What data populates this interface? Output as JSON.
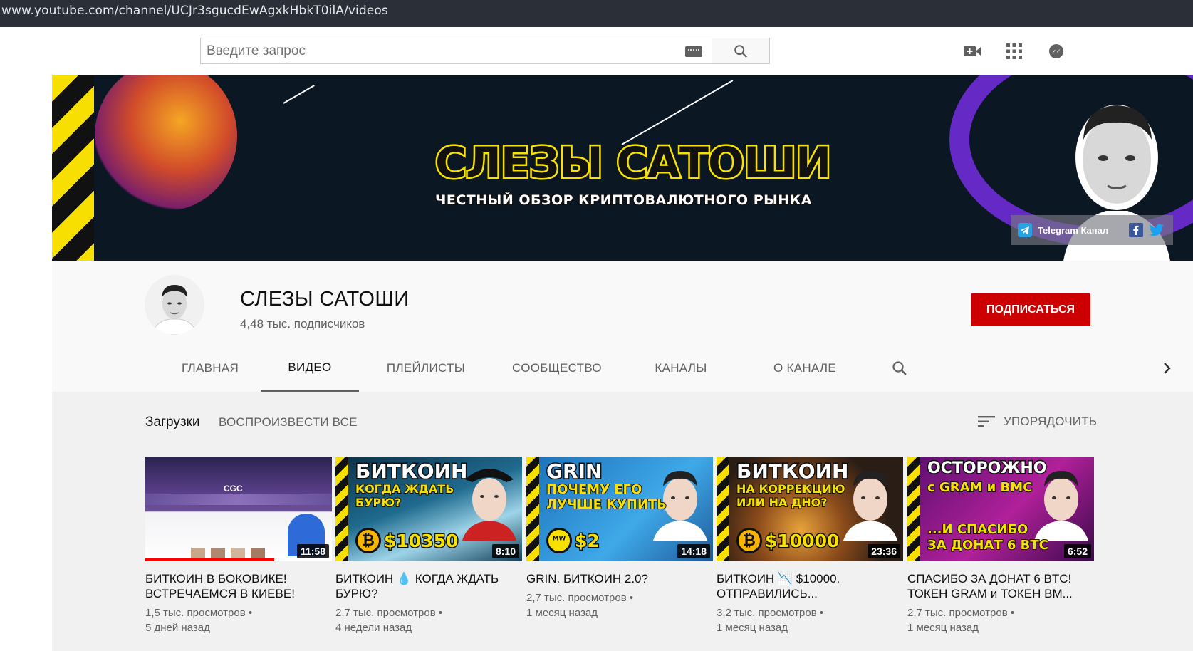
{
  "browser": {
    "url": "www.youtube.com/channel/UCJr3sgucdEwAgxkHbkT0ilA/videos"
  },
  "masthead": {
    "search_placeholder": "Введите запрос"
  },
  "banner": {
    "title": "СЛЕЗЫ САТОШИ",
    "subtitle": "ЧЕСТНЫЙ ОБЗОР КРИПТОВАЛЮТНОГО РЫНКА",
    "telegram_label": "Telegram Канал"
  },
  "channel": {
    "name": "СЛЕЗЫ САТОШИ",
    "subscribers": "4,48 тыс. подписчиков",
    "subscribe_label": "ПОДПИСАТЬСЯ"
  },
  "tabs": [
    {
      "label": "ГЛАВНАЯ"
    },
    {
      "label": "ВИДЕО"
    },
    {
      "label": "ПЛЕЙЛИСТЫ"
    },
    {
      "label": "СООБЩЕСТВО"
    },
    {
      "label": "КАНАЛЫ"
    },
    {
      "label": "О КАНАЛЕ"
    }
  ],
  "shelf": {
    "title": "Загрузки",
    "play_all": "ВОСПРОИЗВЕСТИ ВСЕ",
    "sort_label": "УПОРЯДОЧИТЬ"
  },
  "videos": [
    {
      "title": "БИТКОИН В БОКОВИКЕ! ВСТРЕЧАЕМСЯ В КИЕВЕ!",
      "views": "1,5 тыс. просмотров",
      "age": "5 дней назад",
      "duration": "11:58",
      "watched_fraction": 0.69,
      "thumb_text": [
        "CGC"
      ]
    },
    {
      "title": "БИТКОИН 💧 КОГДА ЖДАТЬ БУРЮ?",
      "views": "2,7 тыс. просмотров",
      "age": "4 недели назад",
      "duration": "8:10",
      "thumb_text": [
        "БИТКОИН",
        "КОГДА ЖДАТЬ БУРЮ?",
        "$10350"
      ]
    },
    {
      "title": "GRIN. БИТКОИН 2.0?",
      "views": "2,7 тыс. просмотров",
      "age": "1 месяц назад",
      "duration": "14:18",
      "thumb_text": [
        "GRIN",
        "ПОЧЕМУ ЕГО ЛУЧШЕ КУПИТЬ",
        "$2"
      ]
    },
    {
      "title": "БИТКОИН 📉 $10000. ОТПРАВИЛИСЬ...",
      "views": "3,2 тыс. просмотров",
      "age": "1 месяц назад",
      "duration": "23:36",
      "thumb_text": [
        "БИТКОИН",
        "НА КОРРЕКЦИЮ ИЛИ НА ДНО?",
        "$10000"
      ]
    },
    {
      "title": "СПАСИБО ЗА ДОНАТ 6 BTC! ТОКЕН GRAM и ТОКЕН ВМ...",
      "views": "2,7 тыс. просмотров",
      "age": "1 месяц назад",
      "duration": "6:52",
      "thumb_text": [
        "ОСТОРОЖНО",
        "с GRAM и BMC",
        "...И СПАСИБО ЗА ДОНАТ 6 BTC"
      ]
    }
  ],
  "colors": {
    "subscribe": "#cc0000",
    "banner_bg": "#0c1724",
    "accent_yellow": "#f7e100"
  },
  "icons": [
    "search-icon",
    "keyboard-icon",
    "create-video-icon",
    "apps-grid-icon",
    "messages-icon",
    "chevron-right-icon",
    "sort-icon",
    "telegram-icon",
    "facebook-icon",
    "twitter-icon"
  ]
}
